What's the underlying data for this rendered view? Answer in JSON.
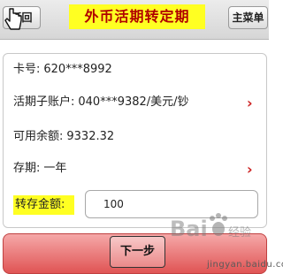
{
  "header": {
    "back_label": "返回",
    "title": "外币活期转定期",
    "menu_label": "主菜单"
  },
  "form": {
    "card_no": {
      "label": "卡号:",
      "value": "620***8992"
    },
    "sub_account": {
      "label": "活期子账户:",
      "value": "040***9382/美元/钞"
    },
    "balance": {
      "label": "可用余额:",
      "value": "9332.32"
    },
    "term": {
      "label": "存期:",
      "value": "一年"
    },
    "amount": {
      "label": "转存金额:",
      "value": "100"
    }
  },
  "footer": {
    "next_label": "下一步"
  },
  "watermark": {
    "logo": "Baidu经验",
    "url": "jingyan.baidu.com"
  },
  "colors": {
    "title_bg": "#ffff22",
    "title_text": "#b00000",
    "chevron": "#cc2222",
    "next_bar": "#e05454"
  },
  "icons": [
    "cursor-icon",
    "chevron-right-icon",
    "baidu-paw-icon"
  ]
}
